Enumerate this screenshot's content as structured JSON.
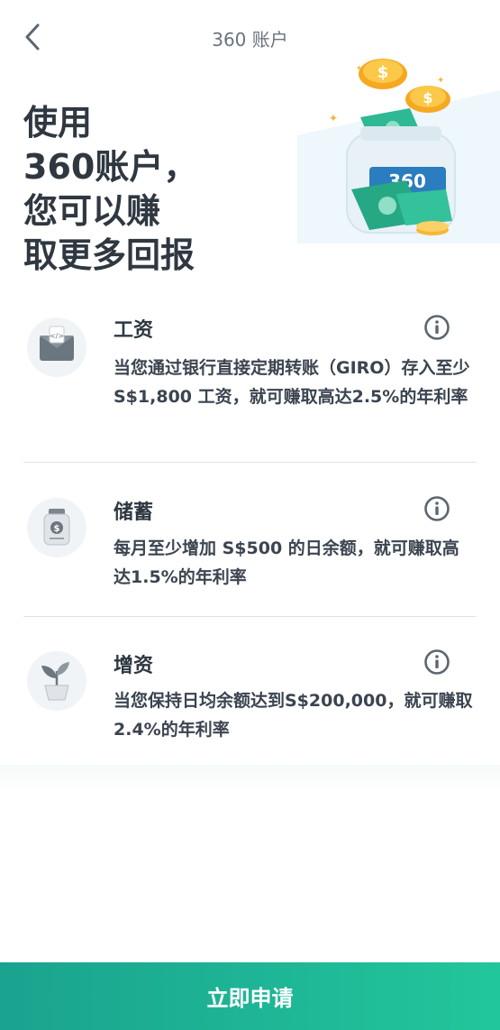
{
  "header": {
    "title": "360 账户",
    "back_icon": "chevron-left-icon"
  },
  "hero": {
    "lines": [
      "使用",
      "360账户，",
      "您可以赚",
      "取更多回报"
    ],
    "jar_label": "360",
    "coin_symbol": "$"
  },
  "features": [
    {
      "icon": "salary-envelope-icon",
      "title": "工资",
      "desc": "当您通过银行直接定期转账（GIRO）存入至少 S$1,800 工资，就可赚取高达2.5%的年利率"
    },
    {
      "icon": "savings-jar-icon",
      "title": "储蓄",
      "desc": "每月至少增加 S$500 的日余额，就可赚取高达1.5%的年利率"
    },
    {
      "icon": "plant-growth-icon",
      "title": "增资",
      "desc": "当您保持日均余额达到S$200,000，就可赚取2.4%的年利率"
    }
  ],
  "cta": {
    "label": "立即申请"
  },
  "colors": {
    "accent_start": "#1aa38f",
    "accent_end": "#22c69c",
    "text_dark": "#2f3841",
    "info_icon": "#5b6670"
  }
}
